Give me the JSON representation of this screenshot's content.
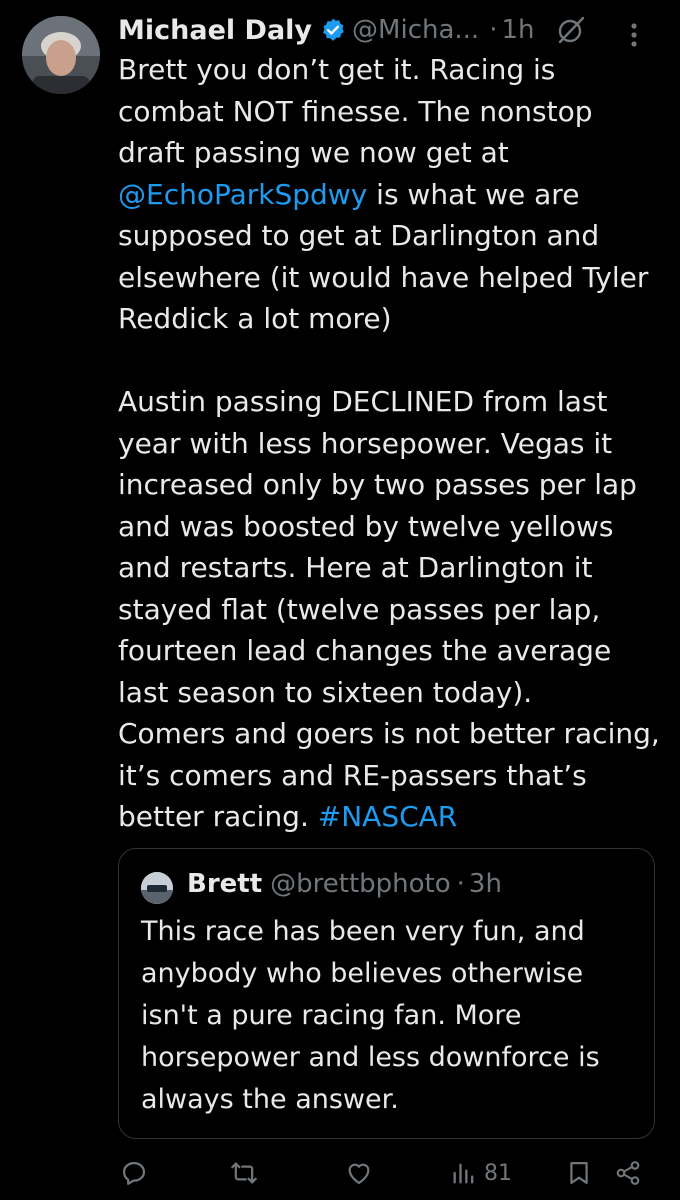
{
  "tweet": {
    "author_name": "Michael Daly",
    "author_handle": "@Micha...",
    "separator": "·",
    "time": "1h",
    "text_lines_a": [
      "Brett you don’t get it.   Racing is",
      "combat NOT finesse.   The nonstop",
      "draft passing we now get at"
    ],
    "mention": "@EchoParkSpdwy",
    "mention_suffix": " is what we are",
    "text_lines_b": [
      "supposed to get at Darlington and",
      "elsewhere (it would have helped Tyler",
      "Reddick a lot more)",
      "",
      "Austin passing DECLINED from last",
      "year with less horsepower.   Vegas it",
      "increased only by two passes per lap",
      "and was boosted by twelve yellows",
      "and restarts.   Here at Darlington it",
      "stayed flat (twelve passes per lap,",
      "fourteen lead changes the average",
      "last season to sixteen today).",
      "Comers and goers is not better racing,",
      "it’s comers and RE-passers that’s"
    ],
    "last_line_prefix": "better racing.   ",
    "hashtag": "#NASCAR"
  },
  "quote": {
    "author_name": "Brett",
    "author_handle": "@brettbphoto",
    "separator": "·",
    "time": "3h",
    "text_lines": [
      "This race has been very fun, and",
      "anybody who believes otherwise",
      "isn't a pure racing fan. More",
      "horsepower and less downforce is",
      "always the answer."
    ]
  },
  "actions": {
    "views": "81"
  },
  "icons": [
    "avatar",
    "verified-badge-icon",
    "grok-icon",
    "more-icon",
    "reply-icon",
    "retweet-icon",
    "like-icon",
    "views-icon",
    "bookmark-icon",
    "share-icon"
  ],
  "colors": {
    "background": "#000000",
    "text": "#e7e9ea",
    "secondary": "#71767b",
    "link": "#1d9bf0",
    "border": "#2f3336"
  }
}
